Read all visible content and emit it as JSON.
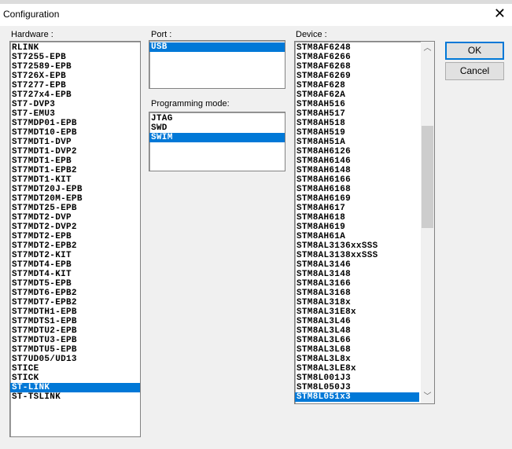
{
  "window": {
    "title": "Configuration"
  },
  "hardware": {
    "label": "Hardware :",
    "selected": "ST-LINK",
    "items": [
      "RLINK",
      "ST7255-EPB",
      "ST72589-EPB",
      "ST726X-EPB",
      "ST7277-EPB",
      "ST727x4-EPB",
      "ST7-DVP3",
      "ST7-EMU3",
      "ST7MDP01-EPB",
      "ST7MDT10-EPB",
      "ST7MDT1-DVP",
      "ST7MDT1-DVP2",
      "ST7MDT1-EPB",
      "ST7MDT1-EPB2",
      "ST7MDT1-KIT",
      "ST7MDT20J-EPB",
      "ST7MDT20M-EPB",
      "ST7MDT25-EPB",
      "ST7MDT2-DVP",
      "ST7MDT2-DVP2",
      "ST7MDT2-EPB",
      "ST7MDT2-EPB2",
      "ST7MDT2-KIT",
      "ST7MDT4-EPB",
      "ST7MDT4-KIT",
      "ST7MDT5-EPB",
      "ST7MDT6-EPB2",
      "ST7MDT7-EPB2",
      "ST7MDTH1-EPB",
      "ST7MDTS1-EPB",
      "ST7MDTU2-EPB",
      "ST7MDTU3-EPB",
      "ST7MDTU5-EPB",
      "ST7UD05/UD13",
      "STICE",
      "STICK",
      "ST-LINK",
      "ST-TSLINK"
    ]
  },
  "port": {
    "label": "Port :",
    "selected": "USB",
    "items": [
      "USB"
    ]
  },
  "programming_mode": {
    "label": "Programming mode:",
    "selected": "SWIM",
    "items": [
      "JTAG",
      "SWD",
      "SWIM"
    ]
  },
  "device": {
    "label": "Device :",
    "selected": "STM8L051x3",
    "items": [
      "STM8AF6248",
      "STM8AF6266",
      "STM8AF6268",
      "STM8AF6269",
      "STM8AF628",
      "STM8AF62A",
      "STM8AH516",
      "STM8AH517",
      "STM8AH518",
      "STM8AH519",
      "STM8AH51A",
      "STM8AH6126",
      "STM8AH6146",
      "STM8AH6148",
      "STM8AH6166",
      "STM8AH6168",
      "STM8AH6169",
      "STM8AH617",
      "STM8AH618",
      "STM8AH619",
      "STM8AH61A",
      "STM8AL3136xxSSS",
      "STM8AL3138xxSSS",
      "STM8AL3146",
      "STM8AL3148",
      "STM8AL3166",
      "STM8AL3168",
      "STM8AL318x",
      "STM8AL31E8x",
      "STM8AL3L46",
      "STM8AL3L48",
      "STM8AL3L66",
      "STM8AL3L68",
      "STM8AL3L8x",
      "STM8AL3LE8x",
      "STM8L001J3",
      "STM8L050J3",
      "STM8L051x3"
    ]
  },
  "buttons": {
    "ok": "OK",
    "cancel": "Cancel"
  }
}
